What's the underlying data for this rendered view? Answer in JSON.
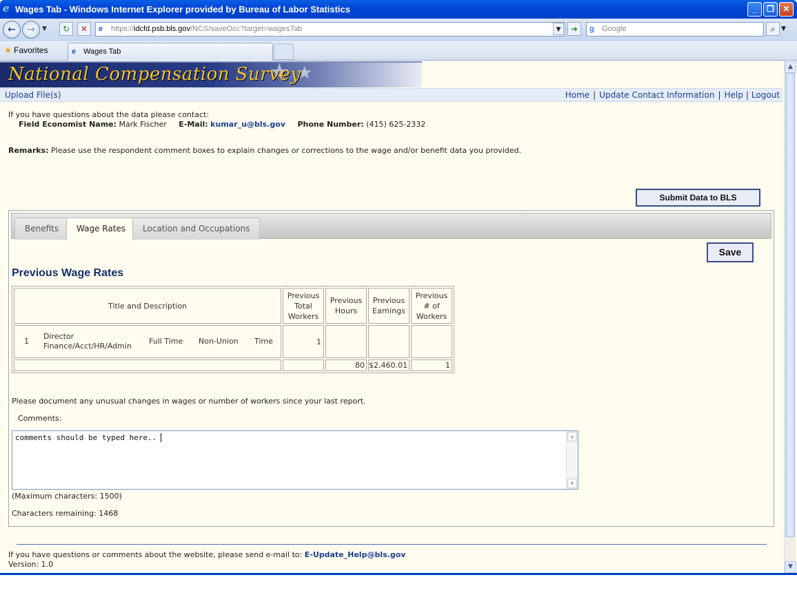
{
  "window": {
    "title": "Wages Tab - Windows Internet Explorer provided by Bureau of Labor Statistics"
  },
  "browser": {
    "url_prefix": "https://",
    "url_domain": "idcfd.psb.bls.gov",
    "url_path": "/NCS/saveOcc?target=wagesTab",
    "search_placeholder": "Google",
    "favorites_label": "Favorites",
    "tab_title": "Wages Tab"
  },
  "site": {
    "banner_title": "National Compensation Survey",
    "upload_link": "Upload File(s)",
    "nav": {
      "home": "Home",
      "update_contact": "Update Contact Information",
      "help": "Help",
      "logout": "Logout",
      "separator": "|"
    }
  },
  "contact": {
    "intro": "If you have questions about the data please contact:",
    "economist_label": "Field Economist Name:",
    "economist_name": "Mark Fischer",
    "email_label": "E-Mail:",
    "email": "kumar_u@bls.gov",
    "phone_label": "Phone Number:",
    "phone": "(415) 625-2332"
  },
  "remarks": {
    "label": "Remarks:",
    "text": "Please use the respondent comment boxes to explain changes or corrections to the wage and/or benefit data you provided."
  },
  "buttons": {
    "submit": "Submit Data to BLS",
    "save": "Save"
  },
  "tabs": [
    {
      "label": "Benefits",
      "active": false
    },
    {
      "label": "Wage Rates",
      "active": true
    },
    {
      "label": "Location and Occupations",
      "active": false
    }
  ],
  "section_title": "Previous Wage Rates",
  "table": {
    "headers": {
      "title_desc": "Title and Description",
      "total_workers": "Previous Total Workers",
      "hours": "Previous Hours",
      "earnings": "Previous Earnings",
      "num_workers": "Previous # of Workers"
    },
    "row": {
      "index": "1",
      "title": "Director Finance/Acct/HR/Admin",
      "schedule": "Full Time",
      "union": "Non-Union",
      "pay_type": "Time",
      "total_workers": "1",
      "hours": "",
      "earnings": "",
      "num_workers": ""
    },
    "subrow": {
      "hours": "80",
      "earnings": "$2,460.01",
      "num_workers": "1"
    }
  },
  "notes_text": "Please document any unusual changes in wages or number of workers since your last report.",
  "comments_label": "Comments:",
  "comment_value": "comments should be typed here..",
  "max_chars": "(Maximum characters: 1500)",
  "chars_remaining": "Characters remaining: 1468",
  "footer": {
    "text": "If you have questions or comments about the website, please send e-mail to:",
    "email": "E-Update_Help@bls.gov",
    "version": "Version: 1.0"
  }
}
